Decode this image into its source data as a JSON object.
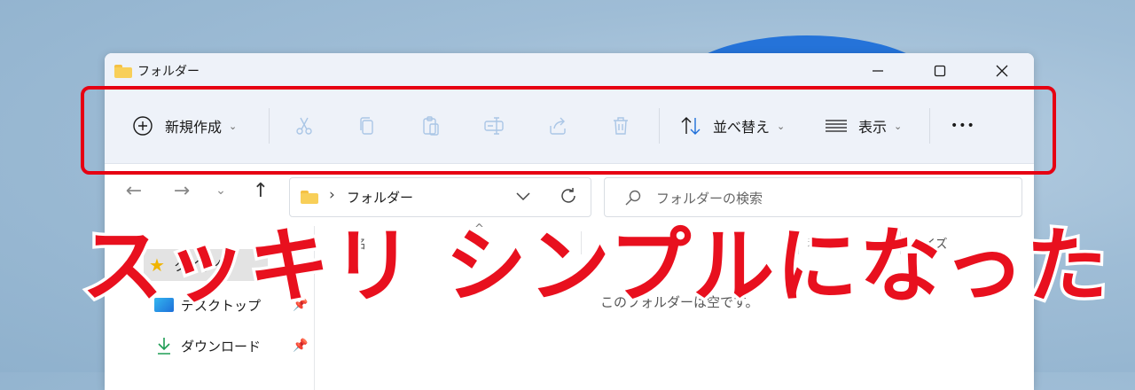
{
  "window": {
    "title": "フォルダー"
  },
  "window_controls": {
    "minimize": "─",
    "maximize": "☐",
    "close": "✕"
  },
  "toolbar": {
    "new_label": "新規作成",
    "sort_label": "並べ替え",
    "view_label": "表示",
    "more_label": "•••",
    "chevron": "⌄",
    "disabled_icons": [
      "cut-icon",
      "copy-icon",
      "paste-icon",
      "rename-icon",
      "share-icon",
      "delete-icon"
    ]
  },
  "nav": {
    "back": "←",
    "forward": "→",
    "recent": "⌄",
    "up": "↑",
    "address_path": "フォルダー",
    "address_separator": "›",
    "search_placeholder": "フォルダーの検索"
  },
  "sidebar": {
    "items": [
      {
        "label": "クイック",
        "icon": "star-icon"
      },
      {
        "label": "デスクトップ",
        "icon": "desktop-icon",
        "pinned": true
      },
      {
        "label": "ダウンロード",
        "icon": "download-icon",
        "pinned": true
      }
    ]
  },
  "main": {
    "columns": [
      "名",
      "日時",
      "種",
      "サイズ"
    ],
    "empty_text": "このフォルダーは空です。"
  },
  "caption": "スッキリ シンプルになった",
  "colors": {
    "accent_red": "#e60012",
    "toolbar_bg": "#eef2f9",
    "disabled_icon": "#aac6e6",
    "folder_yellow": "#f8cf58"
  }
}
